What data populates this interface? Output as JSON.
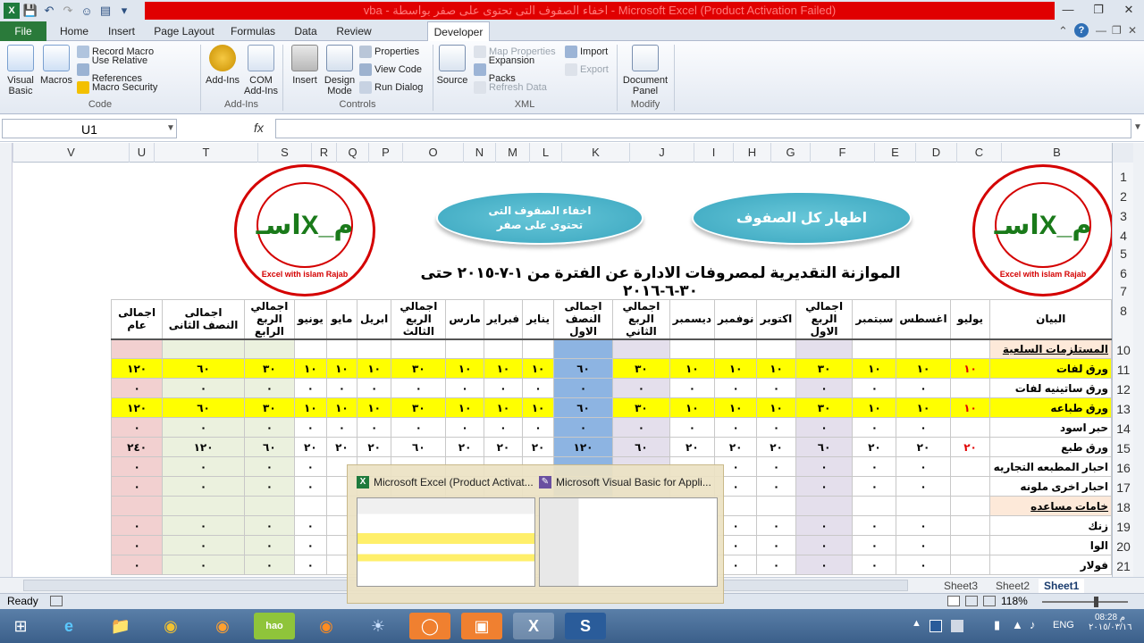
{
  "window": {
    "title": "vba - اخفاء الصفوف التى تحتوى على صفر بواسطة - Microsoft Excel (Product Activation Failed)"
  },
  "ribbon_tabs": [
    "File",
    "Home",
    "Insert",
    "Page Layout",
    "Formulas",
    "Data",
    "Review",
    "Developer"
  ],
  "ribbon": {
    "code": {
      "visual_basic": "Visual Basic",
      "macros": "Macros",
      "record_macro": "Record Macro",
      "relative_refs": "Use Relative References",
      "macro_security": "Macro Security",
      "label": "Code"
    },
    "addins": {
      "addins": "Add-Ins",
      "com_addins": "COM Add-Ins",
      "label": "Add-Ins"
    },
    "controls": {
      "insert": "Insert",
      "design_mode": "Design Mode",
      "properties": "Properties",
      "view_code": "View Code",
      "run_dialog": "Run Dialog",
      "label": "Controls"
    },
    "xml": {
      "source": "Source",
      "map_properties": "Map Properties",
      "expansion_packs": "Expansion Packs",
      "refresh_data": "Refresh Data",
      "import": "Import",
      "export": "Export",
      "label": "XML"
    },
    "modify": {
      "document_panel": "Document Panel",
      "label": "Modify"
    }
  },
  "formula_bar": {
    "name_box": "U1",
    "fx": "fx",
    "formula": ""
  },
  "columns": [
    "V",
    "U",
    "T",
    "S",
    "R",
    "Q",
    "P",
    "O",
    "N",
    "M",
    "L",
    "K",
    "J",
    "I",
    "H",
    "G",
    "F",
    "E",
    "D",
    "C",
    "B"
  ],
  "rows": [
    "1",
    "2",
    "3",
    "4",
    "5",
    "6",
    "7",
    "8",
    "10",
    "11",
    "12",
    "13",
    "14",
    "15",
    "16",
    "17",
    "18",
    "19",
    "20",
    "21"
  ],
  "sheet": {
    "logo_text": "Excel with islam Rajab",
    "logo_arabic": "اكسل مع اسلام رجب",
    "logo_mark": "اسـX_م",
    "button_hide": "اخفاء الصفوف التى تحتوى على صفر",
    "button_show": "اظهار كل الصفوف",
    "title": "الموازنة التقديرية لمصروفات الادارة عن الفترة من ١-٧-٢٠١٥ حتى ٣٠-٦-٢٠١٦",
    "headers": [
      "اجمالى عام",
      "اجمالى النصف الثانى",
      "اجمالي الربع الرابع",
      "يونيو",
      "مايو",
      "ابريل",
      "اجمالي الربع الثالث",
      "مارس",
      "فبراير",
      "يناير",
      "اجمالى النصف الاول",
      "اجمالي الربع الثاني",
      "ديسمبر",
      "نوفمبر",
      "اكتوبر",
      "اجمالي الربع الاول",
      "سبتمبر",
      "اغسطس",
      "يوليو",
      "البيان"
    ],
    "table_rows": [
      {
        "label": "المستلزمات السلعية",
        "values": [
          "",
          "",
          "",
          "",
          "",
          "",
          "",
          "",
          "",
          "",
          "",
          "",
          "",
          "",
          "",
          "",
          "",
          "",
          ""
        ]
      },
      {
        "label": "ورق لفات",
        "values": [
          "١٢٠",
          "٦٠",
          "٣٠",
          "١٠",
          "١٠",
          "١٠",
          "٣٠",
          "١٠",
          "١٠",
          "١٠",
          "٦٠",
          "٣٠",
          "١٠",
          "١٠",
          "١٠",
          "٣٠",
          "١٠",
          "١٠",
          "١٠"
        ]
      },
      {
        "label": "ورق ساتينيه لفات",
        "values": [
          "٠",
          "٠",
          "٠",
          "٠",
          "٠",
          "٠",
          "٠",
          "٠",
          "٠",
          "٠",
          "٠",
          "٠",
          "٠",
          "٠",
          "٠",
          "٠",
          "٠",
          "٠",
          ""
        ]
      },
      {
        "label": "ورق طباعه",
        "values": [
          "١٢٠",
          "٦٠",
          "٣٠",
          "١٠",
          "١٠",
          "١٠",
          "٣٠",
          "١٠",
          "١٠",
          "١٠",
          "٦٠",
          "٣٠",
          "١٠",
          "١٠",
          "١٠",
          "٣٠",
          "١٠",
          "١٠",
          "١٠"
        ]
      },
      {
        "label": "حبر اسود",
        "values": [
          "٠",
          "٠",
          "٠",
          "٠",
          "٠",
          "٠",
          "٠",
          "٠",
          "٠",
          "٠",
          "٠",
          "٠",
          "٠",
          "٠",
          "٠",
          "٠",
          "٠",
          "٠",
          ""
        ]
      },
      {
        "label": "ورق طبع",
        "values": [
          "٢٤٠",
          "١٢٠",
          "٦٠",
          "٢٠",
          "٢٠",
          "٢٠",
          "٦٠",
          "٢٠",
          "٢٠",
          "٢٠",
          "١٢٠",
          "٦٠",
          "٢٠",
          "٢٠",
          "٢٠",
          "٦٠",
          "٢٠",
          "٢٠",
          "٢٠"
        ]
      },
      {
        "label": "احبار المطبعه التجاريه",
        "values": [
          "٠",
          "٠",
          "٠",
          "٠",
          "",
          "",
          "",
          "",
          "",
          "",
          "",
          "",
          "",
          "٠",
          "٠",
          "٠",
          "٠",
          "٠",
          ""
        ]
      },
      {
        "label": "احبار اخرى ملونه",
        "values": [
          "٠",
          "٠",
          "٠",
          "٠",
          "",
          "",
          "",
          "",
          "",
          "",
          "",
          "",
          "",
          "٠",
          "٠",
          "٠",
          "٠",
          "٠",
          ""
        ]
      },
      {
        "label": "خامات مساعده",
        "values": [
          "",
          "",
          "",
          "",
          "",
          "",
          "",
          "",
          "",
          "",
          "",
          "",
          "",
          "",
          "",
          "",
          "",
          "",
          ""
        ]
      },
      {
        "label": "زنك",
        "values": [
          "٠",
          "٠",
          "٠",
          "٠",
          "",
          "",
          "",
          "",
          "",
          "",
          "",
          "",
          "",
          "٠",
          "٠",
          "٠",
          "٠",
          "٠",
          ""
        ]
      },
      {
        "label": "الوا",
        "values": [
          "٠",
          "٠",
          "٠",
          "٠",
          "",
          "",
          "",
          "",
          "",
          "",
          "",
          "",
          "",
          "٠",
          "٠",
          "٠",
          "٠",
          "٠",
          ""
        ]
      },
      {
        "label": "فولار",
        "values": [
          "٠",
          "٠",
          "٠",
          "٠",
          "",
          "",
          "",
          "",
          "",
          "",
          "",
          "",
          "",
          "٠",
          "٠",
          "٠",
          "٠",
          "٠",
          ""
        ]
      }
    ]
  },
  "sheet_tabs": [
    "Sheet3",
    "Sheet2",
    "Sheet1"
  ],
  "status": {
    "ready": "Ready",
    "zoom": "118%"
  },
  "preview": {
    "excel_title": "Microsoft Excel (Product Activat...",
    "vba_title": "Microsoft Visual Basic for Appli..."
  },
  "tray": {
    "lang": "ENG",
    "time": "08:28 م",
    "date": "٢٠١٥/٠٣/١٦"
  }
}
